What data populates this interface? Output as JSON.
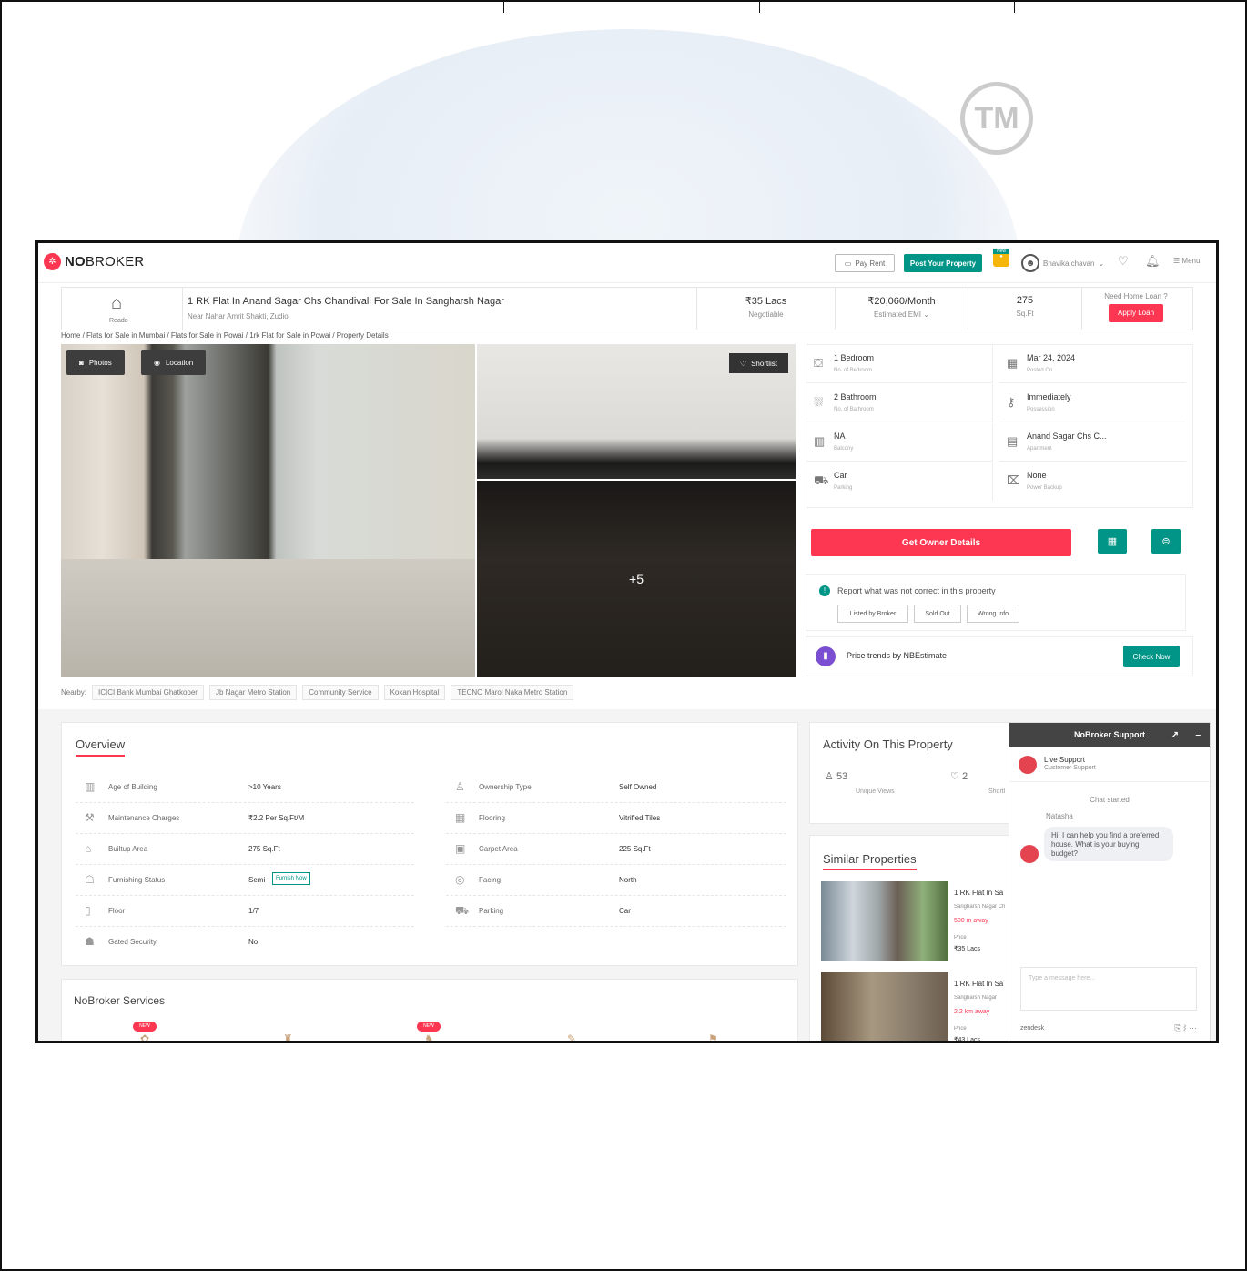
{
  "header": {
    "logo_text_bold": "NO",
    "logo_text_rest": "BROKER",
    "pay_rent": "Pay Rent",
    "post_property": "Post Your Property",
    "new_badge": "New",
    "user_name": "Bhavika chavan",
    "menu": "Menu"
  },
  "listing": {
    "reado_label": "Reado",
    "title": "1 RK Flat In Anand Sagar Chs Chandivali For Sale In Sangharsh Nagar",
    "address": "Near Nahar Amrit Shakti, Zudio",
    "price": "₹35 Lacs",
    "price_note": "Negotiable",
    "emi": "₹20,060/Month",
    "emi_note": "Estimated EMI",
    "area": "275",
    "area_unit": "Sq.Ft",
    "loan_question": "Need Home Loan ?",
    "apply_loan": "Apply Loan"
  },
  "breadcrumb": "Home / Flats for Sale in Mumbai / Flats for Sale in Powai / 1rk Flat for Sale in Powai / Property Details",
  "gallery": {
    "photos": "Photos",
    "location": "Location",
    "shortlist": "Shortlist",
    "more_count": "+5"
  },
  "nearby": {
    "label": "Nearby:",
    "items": [
      "ICICI Bank Mumbai Ghatkoper",
      "Jb Nagar Metro Station",
      "Community Service",
      "Kokan Hospital",
      "TECNO Marol Naka Metro Station"
    ]
  },
  "details": [
    {
      "icon": "bed-icon",
      "value": "1 Bedroom",
      "label": "No. of Bedroom"
    },
    {
      "icon": "calendar-icon",
      "value": "Mar 24, 2024",
      "label": "Posted On"
    },
    {
      "icon": "bath-icon",
      "value": "2 Bathroom",
      "label": "No. of Bathroom"
    },
    {
      "icon": "key-icon",
      "value": "Immediately",
      "label": "Possession"
    },
    {
      "icon": "balcony-icon",
      "value": "NA",
      "label": "Balcony"
    },
    {
      "icon": "building-icon",
      "value": "Anand Sagar Chs C...",
      "label": "Apartment"
    },
    {
      "icon": "car-icon",
      "value": "Car",
      "label": "Parking"
    },
    {
      "icon": "power-icon",
      "value": "None",
      "label": "Power Backup"
    }
  ],
  "actions": {
    "owner_details": "Get Owner Details",
    "report_text": "Report what was not correct in this property",
    "report_buttons": [
      "Listed by Broker",
      "Sold Out",
      "Wrong Info"
    ],
    "price_trends": "Price trends by NBEstimate",
    "check_now": "Check Now"
  },
  "overview": {
    "title": "Overview",
    "left": [
      {
        "key": "Age of Building",
        "value": ">10 Years"
      },
      {
        "key": "Maintenance Charges",
        "value": "₹2.2 Per Sq.Ft/M"
      },
      {
        "key": "Builtup Area",
        "value": "275 Sq.Ft"
      },
      {
        "key": "Furnishing Status",
        "value": "Semi"
      },
      {
        "key": "Floor",
        "value": "1/7"
      },
      {
        "key": "Gated Security",
        "value": "No"
      }
    ],
    "right": [
      {
        "key": "Ownership Type",
        "value": "Self Owned"
      },
      {
        "key": "Flooring",
        "value": "Vitrified Tiles"
      },
      {
        "key": "Carpet Area",
        "value": "225 Sq.Ft"
      },
      {
        "key": "Facing",
        "value": "North"
      },
      {
        "key": "Parking",
        "value": "Car"
      }
    ],
    "furnish_now": "Furnish Now"
  },
  "services": {
    "title": "NoBroker Services",
    "new_label": "NEW"
  },
  "activity": {
    "title": "Activity On This Property",
    "views": "53",
    "views_label": "Unique Views",
    "shortlists": "2",
    "shortlists_label": "Shortl"
  },
  "similar": {
    "title": "Similar Properties",
    "items": [
      {
        "title": "1 RK Flat In Sa",
        "locality": "Sangharsh Nagar Ch",
        "distance": "500 m away",
        "price_label": "Price",
        "price": "₹35 Lacs"
      },
      {
        "title": "1 RK Flat In Sa",
        "locality": "Sangharsh Nagar",
        "distance": "2.2 km away",
        "price_label": "Price",
        "price": "₹43 Lacs"
      }
    ]
  },
  "chat": {
    "title": "NoBroker Support",
    "agent": "Live Support",
    "agent_role": "Customer Support",
    "started": "Chat started",
    "sender": "Natasha",
    "message": "Hi, I can help you find a preferred house. What is your buying budget?",
    "placeholder": "Type a message here...",
    "footer": "zendesk"
  },
  "watermark": {
    "tm": "TM"
  },
  "colors": {
    "brand": "#fd3752",
    "teal": "#009587"
  }
}
